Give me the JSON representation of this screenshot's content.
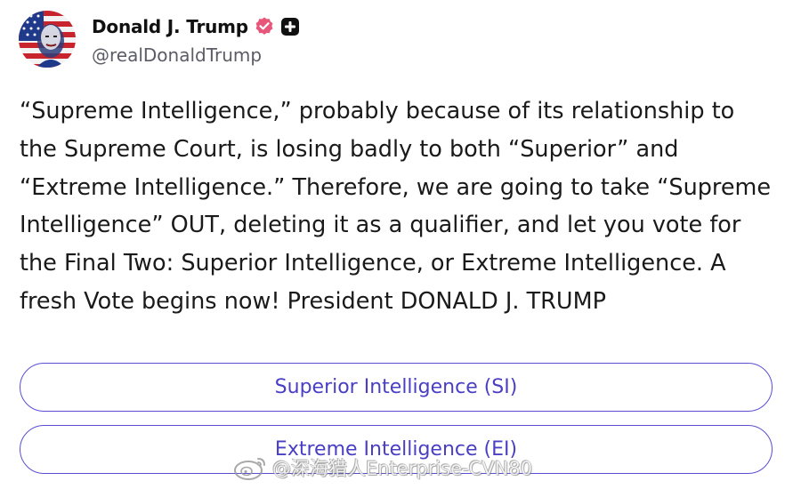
{
  "author": {
    "display_name": "Donald J. Trump",
    "handle": "@realDonaldTrump",
    "avatar_icon": "flag-portrait-avatar",
    "verified_icon": "verified-badge-icon",
    "plus_icon": "plus-badge-icon"
  },
  "post": {
    "text": "“Supreme Intelligence,” probably because of its relationship to\nthe Supreme Court, is losing badly to both “Superior” and\n“Extreme Intelligence.” Therefore, we are going to take “Supreme\nIntelligence” OUT, deleting it as a qualifier, and let you vote for\nthe Final Two: Superior Intelligence, or Extreme Intelligence. A\nfresh Vote begins now! President DONALD J. TRUMP"
  },
  "poll": {
    "options": [
      {
        "label": "Superior Intelligence (SI)"
      },
      {
        "label": "Extreme Intelligence (EI)"
      }
    ]
  },
  "watermark": {
    "text": "@深海猎人Enterprise-CVN80",
    "icon": "weibo-logo-icon"
  },
  "colors": {
    "poll_accent": "#5b4fd1",
    "verified_badge": "#e8577a",
    "text": "#1a1a1a",
    "handle": "#5c5c66"
  }
}
